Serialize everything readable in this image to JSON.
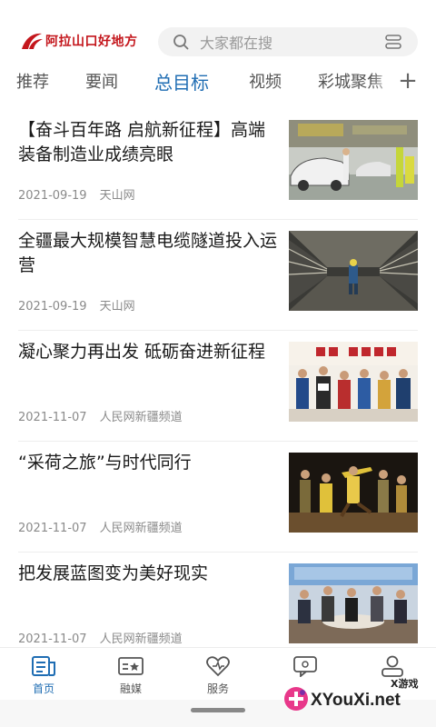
{
  "header": {
    "logo_text": "阿拉山口好地方",
    "search_placeholder": "大家都在搜",
    "brand_color": "#c4161c"
  },
  "tabs": [
    {
      "label": "推荐",
      "active": false
    },
    {
      "label": "要闻",
      "active": false
    },
    {
      "label": "总目标",
      "active": true
    },
    {
      "label": "视频",
      "active": false
    },
    {
      "label": "彩城聚焦",
      "active": false
    }
  ],
  "tab_add_label": "+",
  "accent_color": "#1f6db3",
  "feed": [
    {
      "title": "【奋斗百年路 启航新征程】高端装备制造业成绩亮眼",
      "date": "2021-09-19",
      "source": "天山网",
      "image": "factory-assembly-line"
    },
    {
      "title": "全疆最大规模智慧电缆隧道投入运营",
      "date": "2021-09-19",
      "source": "天山网",
      "image": "cable-tunnel"
    },
    {
      "title": "凝心聚力再出发 砥砺奋进新征程",
      "date": "2021-11-07",
      "source": "人民网新疆频道",
      "image": "group-photo-banner"
    },
    {
      "title": "“采荷之旅”与时代同行",
      "date": "2021-11-07",
      "source": "人民网新疆频道",
      "image": "stage-dance-performance"
    },
    {
      "title": "把发展蓝图变为美好现实",
      "date": "2021-11-07",
      "source": "人民网新疆频道",
      "image": "meeting-people"
    }
  ],
  "bottom_nav": [
    {
      "label": "首页",
      "icon": "news-icon",
      "active": true
    },
    {
      "label": "融媒",
      "icon": "media-icon",
      "active": false
    },
    {
      "label": "服务",
      "icon": "heart-icon",
      "active": false
    },
    {
      "label": "",
      "icon": "chat-icon",
      "active": false
    },
    {
      "label": "",
      "icon": "user-icon",
      "active": false
    }
  ],
  "watermark": {
    "small": "X游戏",
    "big": "XYouXi.net"
  }
}
